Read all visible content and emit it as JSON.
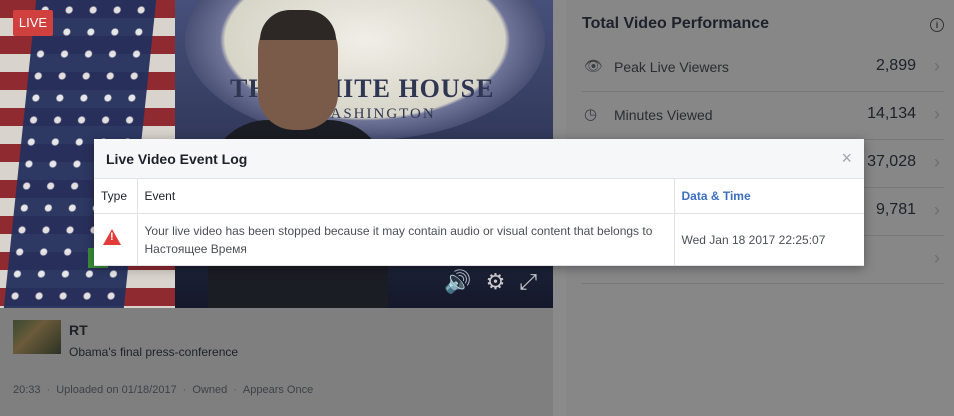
{
  "video": {
    "live_badge": "LIVE",
    "backdrop_text": "THE WHITE HOUSE",
    "backdrop_subtext": "WASHINGTON"
  },
  "video_info": {
    "channel": "RT",
    "description": "Obama's final press-conference",
    "duration": "20:33",
    "uploaded": "Uploaded on 01/18/2017",
    "ownership": "Owned",
    "appearance": "Appears Once"
  },
  "performance": {
    "title": "Total Video Performance",
    "stats": [
      {
        "icon": "eye-icon",
        "label": "Peak Live Viewers",
        "value": "2,899"
      },
      {
        "icon": "clock-icon",
        "label": "Minutes Viewed",
        "value": "14,134"
      },
      {
        "icon": "",
        "label": "",
        "value": "37,028"
      },
      {
        "icon": "",
        "label": "",
        "value": "9,781"
      },
      {
        "icon": "",
        "label": "",
        "value": ""
      }
    ]
  },
  "modal": {
    "title": "Live Video Event Log",
    "close": "×",
    "columns": [
      "Type",
      "Event",
      "Data & Time"
    ],
    "rows": [
      {
        "type_icon": "warning-icon",
        "event": "Your live video has been stopped because it may contain audio or visual content that belongs to Настоящее Время",
        "datetime": "Wed Jan 18 2017 22:25:07"
      }
    ]
  },
  "colors": {
    "live_badge": "#d0403f",
    "warning": "#e23b3b",
    "link": "#3b6fbf"
  }
}
